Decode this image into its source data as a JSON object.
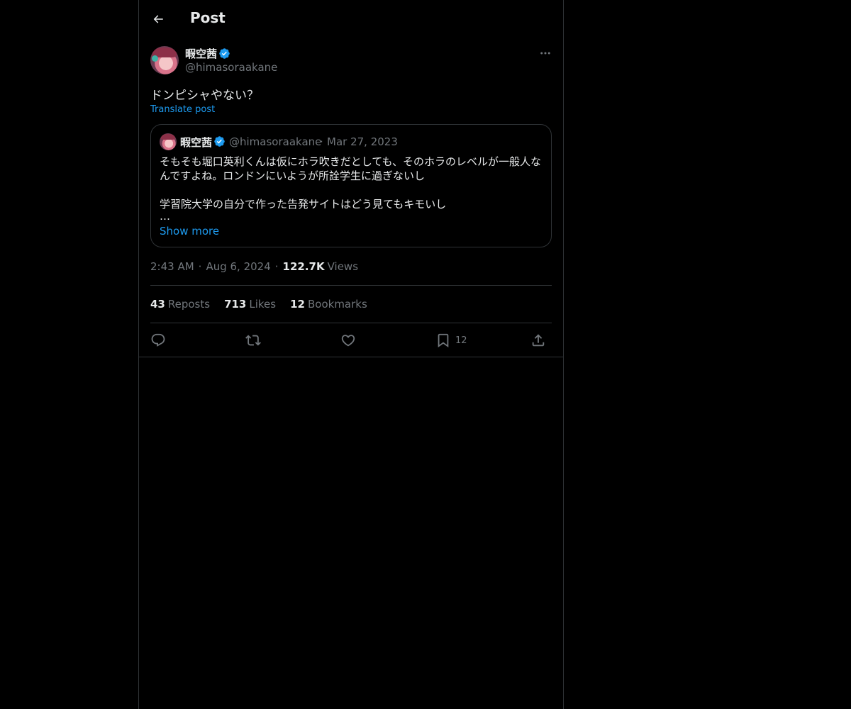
{
  "header": {
    "back_icon": "arrow-left-icon",
    "title": "Post"
  },
  "author": {
    "name": "暇空茜",
    "handle": "@himasoraakane",
    "verified": true,
    "more_icon": "more-horizontal-icon"
  },
  "post": {
    "text": "ドンピシャやない？",
    "translate_label": "Translate post"
  },
  "quote": {
    "name": "暇空茜",
    "handle": "@himasoraakane",
    "separator": "·",
    "date": "Mar 27, 2023",
    "lines": [
      "そもそも堀口英利くんは仮にホラ吹きだとしても、そのホラのレベルが一般人な",
      "んですよね。ロンドンにいようが所詮学生に過ぎないし",
      "学習院大学の自分で作った告発サイトはどう見てもキモいし"
    ],
    "ellipsis": "…",
    "show_more": "Show more"
  },
  "meta": {
    "time": "2:43 AM",
    "separator": "·",
    "date": "Aug 6, 2024",
    "views_count": "122.7K",
    "views_label": "Views"
  },
  "stats": {
    "reposts_count": "43",
    "reposts_label": "Reposts",
    "likes_count": "713",
    "likes_label": "Likes",
    "bookmarks_count": "12",
    "bookmarks_label": "Bookmarks"
  },
  "actions": {
    "reply_icon": "reply-icon",
    "repost_icon": "repost-icon",
    "like_icon": "heart-icon",
    "bookmark_icon": "bookmark-icon",
    "bookmark_count": "12",
    "share_icon": "share-icon"
  },
  "colors": {
    "background": "#000000",
    "text": "#e7e9ea",
    "muted": "#71767b",
    "accent": "#1d9bf0",
    "border": "#2f3336"
  }
}
